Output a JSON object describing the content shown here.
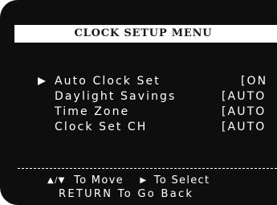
{
  "menu": {
    "title": "CLOCK SETUP MENU",
    "items": [
      {
        "label": "Auto Clock Set",
        "value": "[ON",
        "selected": true
      },
      {
        "label": "Daylight Savings",
        "value": "[AUTO",
        "selected": false
      },
      {
        "label": "Time Zone",
        "value": "[AUTO",
        "selected": false
      },
      {
        "label": "Clock Set CH",
        "value": "[AUTO",
        "selected": false
      }
    ]
  },
  "hints": {
    "move_icon": "up-down-arrows-icon",
    "move_label": "To Move",
    "select_icon": "right-triangle-icon",
    "select_label": "To Select",
    "back_label": "RETURN To Go Back"
  },
  "colors": {
    "background": "#0e0e0e",
    "text": "#ffffff",
    "title_bar": "#ffffff",
    "title_text": "#1a1a1a"
  }
}
